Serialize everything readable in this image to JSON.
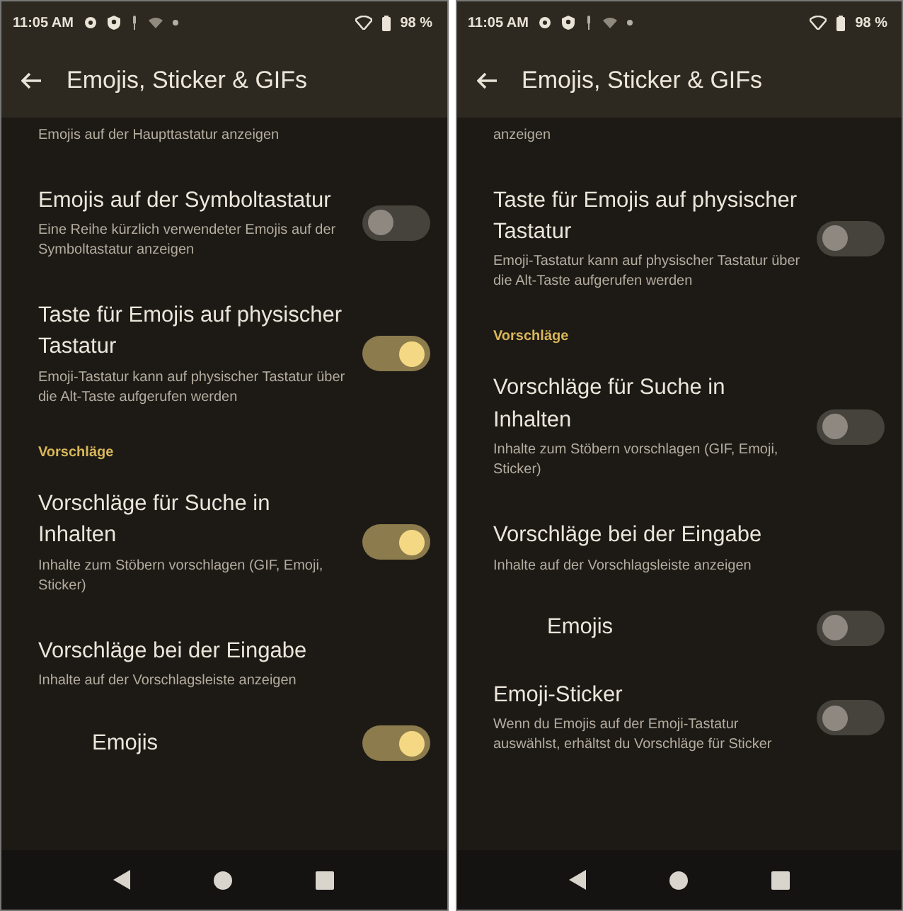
{
  "screens": [
    {
      "status": {
        "time": "11:05 AM",
        "battery": "98 %"
      },
      "title": "Emojis, Sticker & GIFs",
      "items": [
        {
          "kind": "note",
          "text": "Emojis auf der Haupttastatur anzeigen"
        },
        {
          "kind": "toggle",
          "title": "Emojis auf der Symboltastatur",
          "summary": "Eine Reihe kürzlich verwendeter Emojis auf der Symboltastatur anzeigen",
          "on": false
        },
        {
          "kind": "toggle",
          "title": "Taste für Emojis auf physischer Tastatur",
          "summary": "Emoji-Tastatur kann auf physischer Tastatur über die Alt-Taste aufgerufen werden",
          "on": true
        },
        {
          "kind": "header",
          "text": "Vorschläge"
        },
        {
          "kind": "toggle",
          "title": "Vorschläge für Suche in Inhalten",
          "summary": "Inhalte zum Stöbern vorschlagen (GIF, Emoji, Sticker)",
          "on": true
        },
        {
          "kind": "plain",
          "title": "Vorschläge bei der Eingabe",
          "summary": "Inhalte auf der Vorschlagsleiste anzeigen"
        },
        {
          "kind": "subtoggle",
          "title": "Emojis",
          "on": true
        }
      ]
    },
    {
      "status": {
        "time": "11:05 AM",
        "battery": "98 %"
      },
      "title": "Emojis, Sticker & GIFs",
      "items": [
        {
          "kind": "note",
          "text": "anzeigen"
        },
        {
          "kind": "toggle",
          "title": "Taste für Emojis auf physischer Tastatur",
          "summary": "Emoji-Tastatur kann auf physischer Tastatur über die Alt-Taste aufgerufen werden",
          "on": false
        },
        {
          "kind": "header",
          "text": "Vorschläge"
        },
        {
          "kind": "toggle",
          "title": "Vorschläge für Suche in Inhalten",
          "summary": "Inhalte zum Stöbern vorschlagen (GIF, Emoji, Sticker)",
          "on": false
        },
        {
          "kind": "plain",
          "title": "Vorschläge bei der Eingabe",
          "summary": "Inhalte auf der Vorschlagsleiste anzeigen"
        },
        {
          "kind": "subtoggle",
          "title": "Emojis",
          "on": false
        },
        {
          "kind": "toggle",
          "title": "Emoji-Sticker",
          "summary": "Wenn du Emojis auf der Emoji-Tastatur auswählst, erhältst du Vorschläge für Sticker",
          "on": false
        }
      ]
    }
  ]
}
